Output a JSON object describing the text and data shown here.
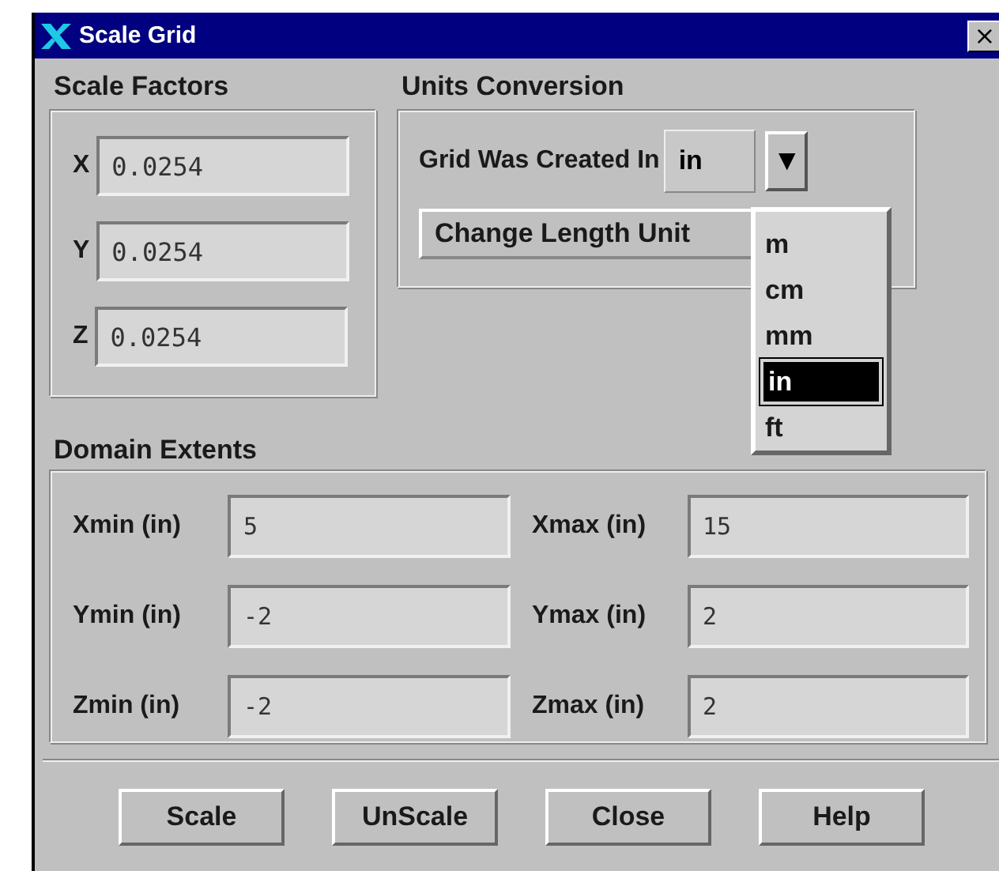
{
  "window": {
    "title": "Scale Grid",
    "close": "×"
  },
  "scale_factors": {
    "title": "Scale Factors",
    "fields": [
      {
        "label": "X",
        "value": "0.0254"
      },
      {
        "label": "Y",
        "value": "0.0254"
      },
      {
        "label": "Z",
        "value": "0.0254"
      }
    ]
  },
  "units_conversion": {
    "title": "Units Conversion",
    "combo_label": "Grid Was Created In",
    "combo_value": "in",
    "arrow": "▼",
    "change_button": "Change Length Unit",
    "options": [
      {
        "label": "m",
        "selected": false
      },
      {
        "label": "cm",
        "selected": false
      },
      {
        "label": "mm",
        "selected": false
      },
      {
        "label": "in",
        "selected": true
      },
      {
        "label": "ft",
        "selected": false
      }
    ]
  },
  "domain_extents": {
    "title": "Domain Extents",
    "fields": [
      {
        "label": "Xmin (in)",
        "value": "5"
      },
      {
        "label": "Xmax (in)",
        "value": "15"
      },
      {
        "label": "Ymin (in)",
        "value": "-2"
      },
      {
        "label": "Ymax (in)",
        "value": "2"
      },
      {
        "label": "Zmin (in)",
        "value": "-2"
      },
      {
        "label": "Zmax (in)",
        "value": "2"
      }
    ]
  },
  "buttons": [
    "Scale",
    "UnScale",
    "Close",
    "Help"
  ]
}
